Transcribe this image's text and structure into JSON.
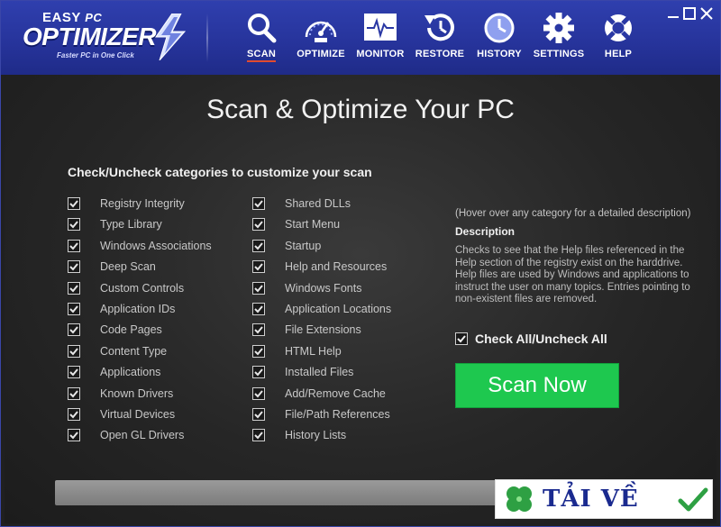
{
  "app": {
    "logo_easy": "EASY",
    "logo_pc": "PC",
    "logo_name": "OPTIMIZER",
    "tagline": "Faster PC in One Click"
  },
  "nav": [
    {
      "label": "SCAN",
      "icon": "search-icon",
      "active": true
    },
    {
      "label": "OPTIMIZE",
      "icon": "speedometer-icon"
    },
    {
      "label": "MONITOR",
      "icon": "pulse-monitor-icon"
    },
    {
      "label": "RESTORE",
      "icon": "restore-clock-icon"
    },
    {
      "label": "HISTORY",
      "icon": "clock-icon"
    },
    {
      "label": "SETTINGS",
      "icon": "gear-icon"
    },
    {
      "label": "HELP",
      "icon": "lifebuoy-icon"
    }
  ],
  "main": {
    "title": "Scan & Optimize Your PC",
    "subtitle": "Check/Uncheck categories to customize your  scan",
    "left_categories": [
      "Registry Integrity",
      "Type Library",
      "Windows Associations",
      "Deep Scan",
      "Custom Controls",
      "Application IDs",
      "Code Pages",
      "Content Type",
      "Applications",
      "Known Drivers",
      "Virtual Devices",
      "Open GL Drivers"
    ],
    "right_categories": [
      "Shared DLLs",
      "Start Menu",
      "Startup",
      "Help and Resources",
      "Windows Fonts",
      "Application Locations",
      "File Extensions",
      "HTML Help",
      "Installed Files",
      "Add/Remove Cache",
      "File/Path References",
      "History Lists"
    ],
    "hint": "(Hover over any category for a detailed description)",
    "description_heading": "Description",
    "description": "Checks to see that the Help files referenced in the Help section of the registry exist on the harddrive. Help files are used by Windows and applications to instruct the user on many topics. Entries pointing to non-existent files are removed.",
    "check_all_label": "Check All/Uncheck All",
    "scan_button": "Scan Now"
  },
  "watermark": {
    "text": "TẢI VỀ"
  },
  "colors": {
    "header": "#2a38a4",
    "accent_underline": "#e24b2f",
    "scan_button": "#1ec84f"
  }
}
